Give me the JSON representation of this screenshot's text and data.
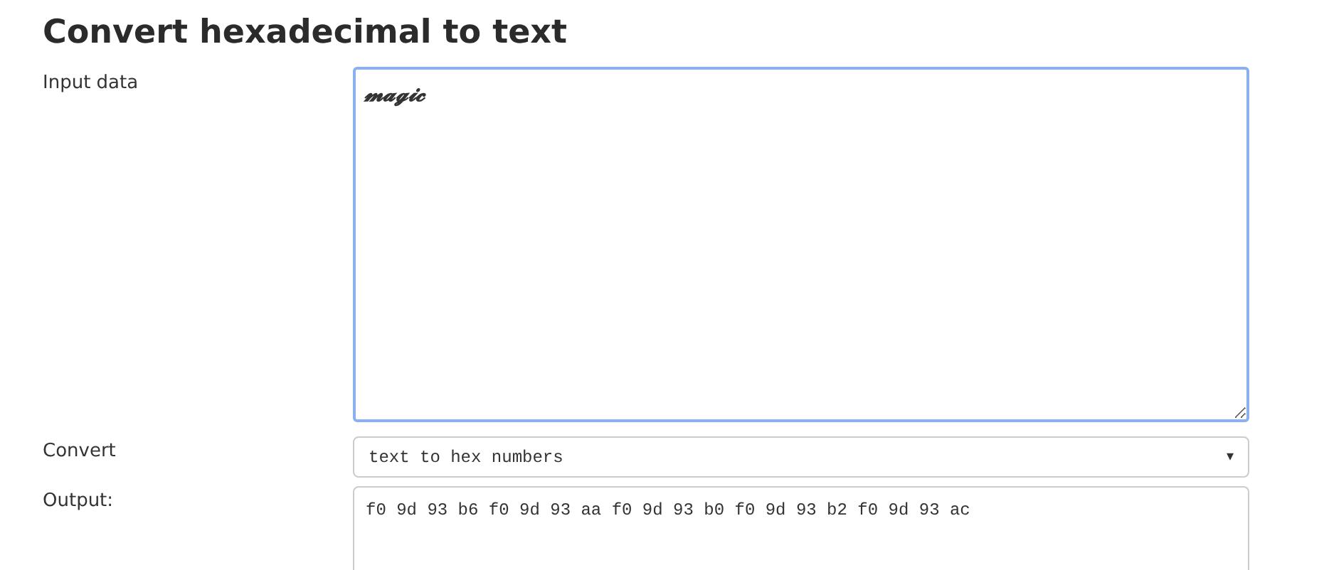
{
  "title": "Convert hexadecimal to text",
  "input": {
    "label": "Input data",
    "value": "𝓶𝓪𝓰𝓲𝓬"
  },
  "convert": {
    "label": "Convert",
    "value": "text to hex numbers",
    "arrow": "▾"
  },
  "output": {
    "label": "Output:",
    "value": "f0 9d 93 b6 f0 9d 93 aa f0 9d 93 b0 f0 9d 93 b2 f0 9d 93 ac"
  }
}
